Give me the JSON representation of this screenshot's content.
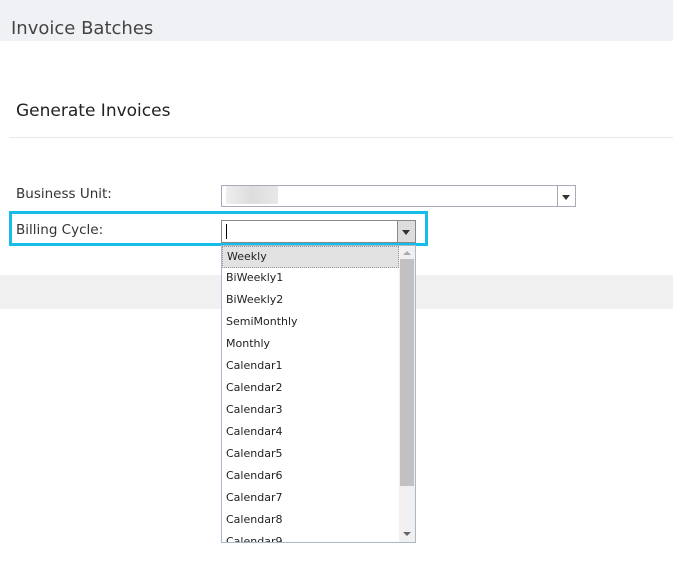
{
  "header": {
    "title": "Invoice Batches"
  },
  "section": {
    "title": "Generate Invoices"
  },
  "form": {
    "business_unit": {
      "label": "Business Unit:",
      "value": ""
    },
    "billing_cycle": {
      "label": "Billing Cycle:",
      "value": "",
      "highlight_color": "#16bde8"
    }
  },
  "dropdown": {
    "options": [
      "Weekly",
      "BiWeekly1",
      "BiWeekly2",
      "SemiMonthly",
      "Monthly",
      "Calendar1",
      "Calendar2",
      "Calendar3",
      "Calendar4",
      "Calendar5",
      "Calendar6",
      "Calendar7",
      "Calendar8",
      "Calendar9"
    ],
    "highlighted": "Weekly"
  }
}
